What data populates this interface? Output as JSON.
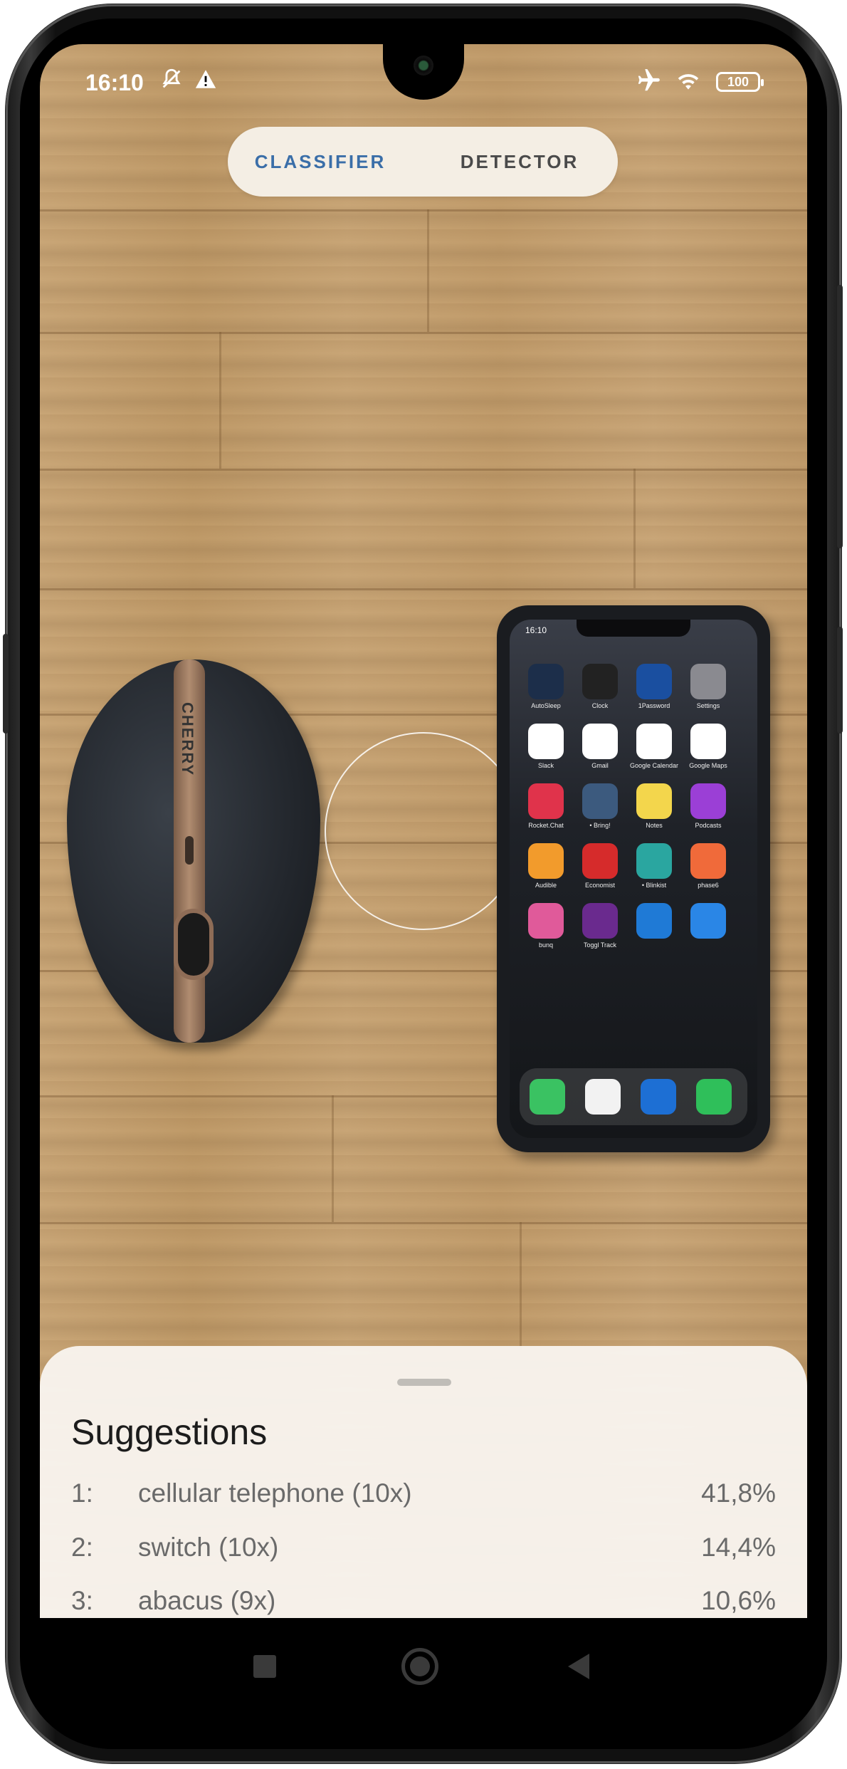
{
  "status_bar": {
    "time": "16:10",
    "battery": "100"
  },
  "mode_tabs": [
    {
      "label": "CLASSIFIER",
      "selected": true
    },
    {
      "label": "DETECTOR",
      "selected": false
    }
  ],
  "scene": {
    "mouse_brand": "CHERRY",
    "phone_time": "16:10",
    "phone_apps": [
      {
        "label": "AutoSleep",
        "color": "#1c2e4a"
      },
      {
        "label": "Clock",
        "color": "#222222"
      },
      {
        "label": "1Password",
        "color": "#1a4fa0"
      },
      {
        "label": "Settings",
        "color": "#8a8a90"
      },
      {
        "label": "Slack",
        "color": "#ffffff"
      },
      {
        "label": "Gmail",
        "color": "#ffffff"
      },
      {
        "label": "Google Calendar",
        "color": "#ffffff"
      },
      {
        "label": "Google Maps",
        "color": "#ffffff"
      },
      {
        "label": "Rocket.Chat",
        "color": "#e0334b"
      },
      {
        "label": "• Bring!",
        "color": "#3c5a7e"
      },
      {
        "label": "Notes",
        "color": "#f3d64c"
      },
      {
        "label": "Podcasts",
        "color": "#9b3fd6"
      },
      {
        "label": "Audible",
        "color": "#f29b2c"
      },
      {
        "label": "Economist",
        "color": "#d62b2b"
      },
      {
        "label": "• Blinkist",
        "color": "#2aa6a0"
      },
      {
        "label": "phase6",
        "color": "#f06a3a"
      },
      {
        "label": "bunq",
        "color": "#e05a9a"
      },
      {
        "label": "Toggl Track",
        "color": "#6a2a8e"
      },
      {
        "label": "",
        "color": "#1f7ad6"
      },
      {
        "label": "",
        "color": "#2a86e6"
      }
    ],
    "dock_apps": [
      {
        "name": "phone-app-icon",
        "color": "#3ac262"
      },
      {
        "name": "chrome-app-icon",
        "color": "#f2f2f2"
      },
      {
        "name": "trello-app-icon",
        "color": "#1d6fd4"
      },
      {
        "name": "whatsapp-app-icon",
        "color": "#2fbf5a"
      }
    ]
  },
  "suggestions": {
    "title": "Suggestions",
    "items": [
      {
        "index": "1:",
        "label": "cellular telephone (10x)",
        "percent": "41,8%"
      },
      {
        "index": "2:",
        "label": "switch (10x)",
        "percent": "14,4%"
      },
      {
        "index": "3:",
        "label": "abacus (9x)",
        "percent": "10,6%"
      }
    ]
  },
  "colors": {
    "accent_tab": "#3a6ea8",
    "inactive_tab": "#4a4a4a"
  }
}
